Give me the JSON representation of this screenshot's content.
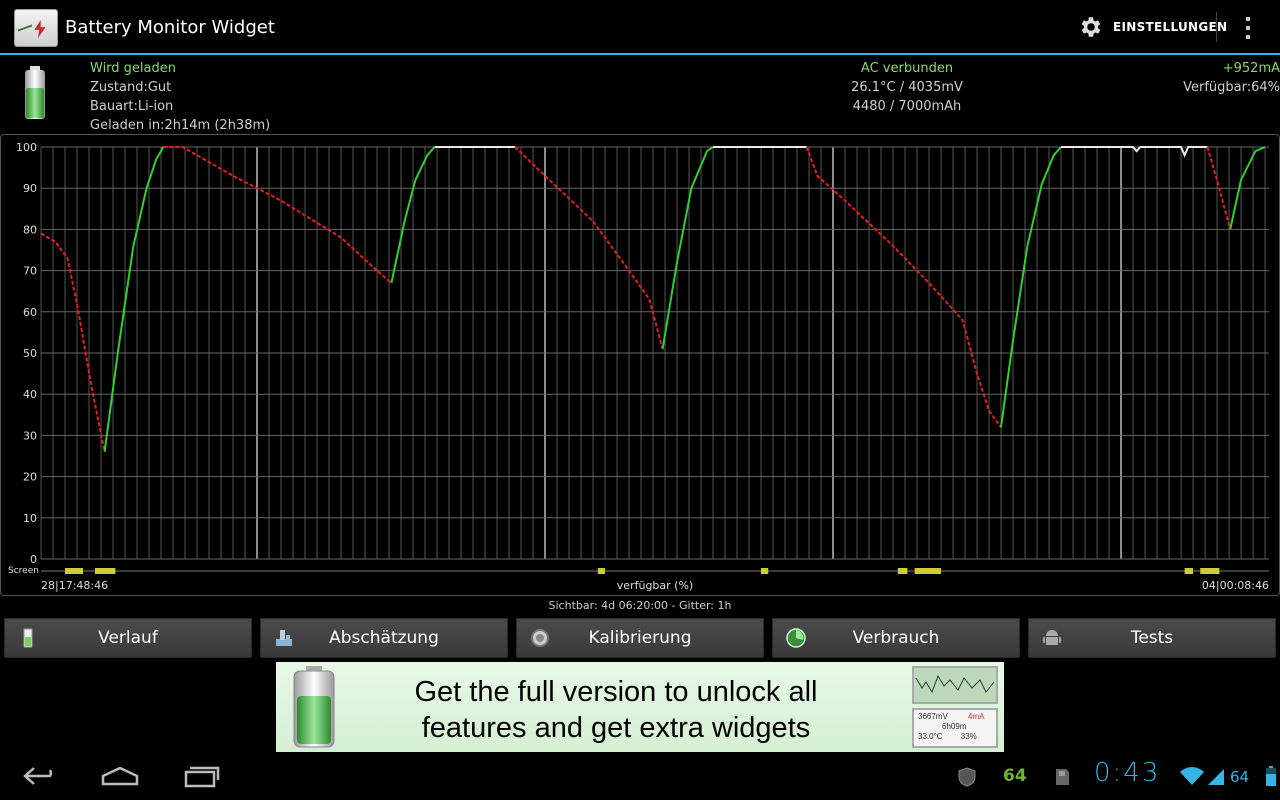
{
  "app": {
    "title": "Battery Monitor Widget",
    "settings_label": "EINSTELLUNGEN"
  },
  "info": {
    "status": "Wird geladen",
    "condition": "Zustand:Gut",
    "type": "Bauart:Li-ion",
    "charged_in": "Geladen in:2h14m (2h38m)",
    "power_source": "AC verbunden",
    "temp_voltage": "26.1°C / 4035mV",
    "capacity": "4480 / 7000mAh",
    "current": "+952mA",
    "available": "Verfügbar:64%"
  },
  "graph": {
    "screen_label": "Screen",
    "start_label": "28|17:48:46",
    "center_label": "verfügbar (%)",
    "end_label": "04|00:08:46",
    "visible_info": "Sichtbar: 4d 06:20:00 - Gitter: 1h"
  },
  "chart_data": {
    "type": "line",
    "xlabel": "verfügbar (%)",
    "ylabel": "",
    "ylim": [
      0,
      100
    ],
    "yticks": [
      0,
      10,
      20,
      30,
      40,
      50,
      60,
      70,
      80,
      90,
      100
    ],
    "x_start": "28|17:48:46",
    "x_end": "04|00:08:46",
    "x_hours_total": 102.33,
    "grid": true,
    "colors": {
      "discharge": "#e02020",
      "charge": "#30d030",
      "full": "#e8e8e8",
      "screen_on": "#cccc33"
    },
    "points": [
      [
        0.0,
        79
      ],
      [
        1.2,
        77
      ],
      [
        2.2,
        73
      ],
      [
        3.0,
        62
      ],
      [
        4.2,
        42
      ],
      [
        5.3,
        26
      ],
      [
        6.4,
        50
      ],
      [
        7.7,
        76
      ],
      [
        8.8,
        90
      ],
      [
        9.6,
        97
      ],
      [
        10.2,
        100
      ],
      [
        11.8,
        100
      ],
      [
        13.0,
        98
      ],
      [
        16.0,
        93
      ],
      [
        20.0,
        87
      ],
      [
        25.0,
        78
      ],
      [
        28.0,
        70
      ],
      [
        29.2,
        67
      ],
      [
        30.3,
        82
      ],
      [
        31.2,
        92
      ],
      [
        32.2,
        98
      ],
      [
        32.8,
        100
      ],
      [
        39.5,
        100
      ],
      [
        42.0,
        93
      ],
      [
        46.0,
        82
      ],
      [
        49.0,
        70
      ],
      [
        50.7,
        63
      ],
      [
        51.8,
        51
      ],
      [
        53.0,
        72
      ],
      [
        54.2,
        90
      ],
      [
        55.5,
        99
      ],
      [
        56.0,
        100
      ],
      [
        63.8,
        100
      ],
      [
        64.7,
        93
      ],
      [
        67.0,
        87
      ],
      [
        71.0,
        76
      ],
      [
        74.0,
        67
      ],
      [
        76.8,
        58
      ],
      [
        78.0,
        45
      ],
      [
        79.0,
        36
      ],
      [
        80.0,
        32
      ],
      [
        81.0,
        53
      ],
      [
        82.2,
        76
      ],
      [
        83.4,
        91
      ],
      [
        84.4,
        98
      ],
      [
        85.0,
        100
      ],
      [
        91.0,
        100
      ],
      [
        91.3,
        99
      ],
      [
        91.6,
        100
      ],
      [
        95.0,
        100
      ],
      [
        95.3,
        98
      ],
      [
        95.6,
        100
      ],
      [
        97.2,
        100
      ],
      [
        98.0,
        92
      ],
      [
        99.1,
        80
      ],
      [
        100.0,
        92
      ],
      [
        101.2,
        99
      ],
      [
        102.0,
        100
      ]
    ],
    "segments": [
      {
        "state": "discharge",
        "from": 0.0,
        "to": 5.3
      },
      {
        "state": "charge",
        "from": 5.3,
        "to": 10.2
      },
      {
        "state": "discharge",
        "from": 10.2,
        "to": 29.2
      },
      {
        "state": "charge",
        "from": 29.2,
        "to": 32.8
      },
      {
        "state": "full",
        "from": 32.8,
        "to": 39.5
      },
      {
        "state": "discharge",
        "from": 39.5,
        "to": 51.8
      },
      {
        "state": "charge",
        "from": 51.8,
        "to": 56.0
      },
      {
        "state": "full",
        "from": 56.0,
        "to": 63.8
      },
      {
        "state": "discharge",
        "from": 63.8,
        "to": 80.0
      },
      {
        "state": "charge",
        "from": 80.0,
        "to": 85.0
      },
      {
        "state": "full",
        "from": 85.0,
        "to": 97.2
      },
      {
        "state": "discharge",
        "from": 97.2,
        "to": 99.1
      },
      {
        "state": "charge",
        "from": 99.1,
        "to": 102.0
      }
    ],
    "screen_on": [
      [
        2.0,
        3.5
      ],
      [
        4.5,
        6.2
      ],
      [
        46.4,
        47.0
      ],
      [
        60.0,
        60.6
      ],
      [
        71.4,
        72.2
      ],
      [
        72.8,
        75.0
      ],
      [
        95.3,
        96.0
      ],
      [
        96.6,
        98.2
      ]
    ]
  },
  "buttons": [
    {
      "label": "Verlauf",
      "icon": "history-icon"
    },
    {
      "label": "Abschätzung",
      "icon": "estimate-icon"
    },
    {
      "label": "Kalibrierung",
      "icon": "calibration-icon"
    },
    {
      "label": "Verbrauch",
      "icon": "usage-icon"
    },
    {
      "label": "Tests",
      "icon": "android-icon"
    }
  ],
  "ad": {
    "line1": "Get the full version to unlock all",
    "line2": "features and get extra widgets",
    "thumb_values": [
      "3667mV",
      "4mA",
      "6h09m",
      "33.0°C",
      "33%"
    ]
  },
  "statusbar": {
    "battery_number": "64",
    "clock": "0:43",
    "battery_level": "64"
  }
}
